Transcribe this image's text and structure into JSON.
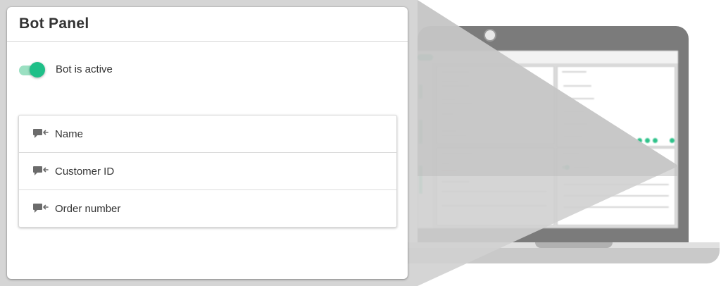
{
  "panel": {
    "title": "Bot Panel",
    "toggle": {
      "label": "Bot is active",
      "on": true
    },
    "fields": [
      {
        "label": "Name",
        "icon": "chat-bubble-arrow-icon"
      },
      {
        "label": "Customer ID",
        "icon": "chat-bubble-arrow-icon"
      },
      {
        "label": "Order number",
        "icon": "chat-bubble-arrow-icon"
      }
    ]
  },
  "colors": {
    "accent": "#1fbf88",
    "accent_light": "#9be0c2",
    "text": "#333333",
    "laptop": "#7b7b7b",
    "wedge": "#cfcfcf"
  }
}
